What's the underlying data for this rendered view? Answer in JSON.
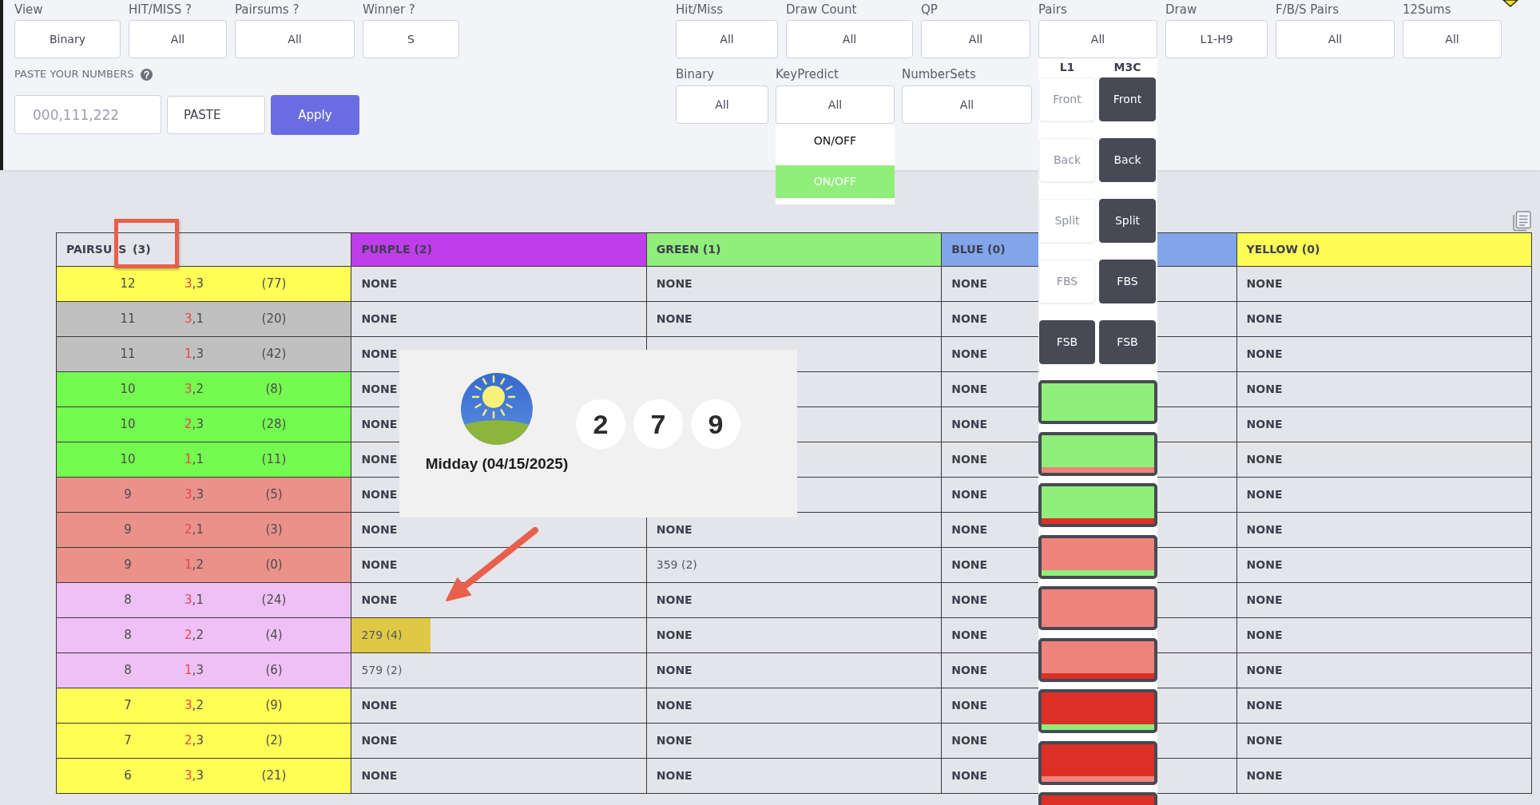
{
  "left_filters": [
    {
      "label": "View",
      "value": "Binary"
    },
    {
      "label": "HIT/MISS ?",
      "value": "All"
    },
    {
      "label": "Pairsums ?",
      "value": "All"
    },
    {
      "label": "Winner ?",
      "value": "S"
    }
  ],
  "paste_numbers": {
    "label": "PASTE YOUR NUMBERS",
    "placeholder": "000,111,222",
    "paste_button": "PASTE",
    "apply_button": "Apply"
  },
  "right_filters": [
    {
      "label": "Hit/Miss",
      "value": "All"
    },
    {
      "label": "Draw Count",
      "value": "All"
    },
    {
      "label": "QP",
      "value": "All"
    },
    {
      "label": "Pairs",
      "value": "All",
      "dropdown": {
        "kind": "pair_toggles",
        "headers": [
          "L1",
          "M3C"
        ],
        "rows": [
          [
            {
              "label": "Front",
              "selected": false
            },
            {
              "label": "Front",
              "selected": true
            }
          ],
          [
            {
              "label": "Back",
              "selected": false
            },
            {
              "label": "Back",
              "selected": true
            }
          ],
          [
            {
              "label": "Split",
              "selected": false
            },
            {
              "label": "Split",
              "selected": true
            }
          ],
          [
            {
              "label": "FBS",
              "selected": false
            },
            {
              "label": "FBS",
              "selected": true
            }
          ],
          [
            {
              "label": "FSB",
              "selected": true
            },
            {
              "label": "FSB",
              "selected": true
            }
          ]
        ],
        "swatches": [
          {
            "color": "#90ee7a"
          },
          {
            "color": "#90ee7a",
            "stripe": {
              "color": "#ef837c"
            }
          },
          {
            "color": "#90ee7a",
            "stripe": {
              "color": "#dc3026"
            }
          },
          {
            "color": "#ef837c",
            "stripe": {
              "color": "#90ee7a"
            }
          },
          {
            "color": "#ef837c"
          },
          {
            "color": "#ef837c",
            "stripe": {
              "color": "#dc3026"
            }
          },
          {
            "color": "#dc3026",
            "stripe": {
              "color": "#90ee7a"
            }
          },
          {
            "color": "#dc3026",
            "stripe": {
              "color": "#ef837c"
            }
          },
          {
            "color": "#dc3026"
          }
        ]
      }
    },
    {
      "label": "Draw",
      "value": "L1-H9"
    },
    {
      "label": "F/B/S Pairs",
      "value": "All"
    },
    {
      "label": "12Sums",
      "value": "All"
    }
  ],
  "right_filters_row2": [
    {
      "label": "Binary",
      "value": "All"
    },
    {
      "label": "KeyPredict",
      "value": "All",
      "dropdown": {
        "kind": "switch_list",
        "items": [
          {
            "label": "ON/OFF",
            "on": false
          },
          {
            "label": "ON/OFF",
            "on": true
          }
        ]
      }
    },
    {
      "label": "NumberSets",
      "value": "All"
    }
  ],
  "table": {
    "columns": [
      {
        "label": "PAIRSU S (3)",
        "color": "#e4e5ea"
      },
      {
        "label": "PURPLE (2)",
        "color": "#bf3deb"
      },
      {
        "label": "GREEN (1)",
        "color": "#90ee7a"
      },
      {
        "label": "BLUE (0)",
        "color": "#82a4eb"
      },
      {
        "label": "YELLOW (0)",
        "color": "#fffd55"
      }
    ],
    "rows": [
      {
        "cells": [
          {
            "kind": "pairsum",
            "sum": "12",
            "pair_hit": "3",
            "pair_rest": ",3",
            "count": "(77)",
            "color": "#ffff55"
          },
          {
            "kind": "none",
            "text": "NONE",
            "highlighted": false
          },
          {
            "kind": "none",
            "text": "NONE",
            "highlighted": false
          },
          {
            "kind": "none",
            "text": "NONE",
            "highlighted": false
          },
          {
            "kind": "none",
            "text": "NONE",
            "highlighted": false
          }
        ]
      },
      {
        "cells": [
          {
            "kind": "pairsum",
            "sum": "11",
            "pair_hit": "3",
            "pair_rest": ",1",
            "count": "(20)",
            "color": "#c0c0c0"
          },
          {
            "kind": "none",
            "text": "NONE",
            "highlighted": false
          },
          {
            "kind": "none",
            "text": "NONE",
            "highlighted": false
          },
          {
            "kind": "none",
            "text": "NONE",
            "highlighted": false
          },
          {
            "kind": "none",
            "text": "NONE",
            "highlighted": false
          }
        ]
      },
      {
        "cells": [
          {
            "kind": "pairsum",
            "sum": "11",
            "pair_hit": "1",
            "pair_rest": ",3",
            "count": "(42)",
            "color": "#c0c0c0"
          },
          {
            "kind": "none",
            "text": "NONE",
            "highlighted": false
          },
          null,
          {
            "kind": "none",
            "text": "NONE",
            "highlighted": false
          },
          {
            "kind": "none",
            "text": "NONE",
            "highlighted": false
          }
        ]
      },
      {
        "cells": [
          {
            "kind": "pairsum",
            "sum": "10",
            "pair_hit": "3",
            "pair_rest": ",2",
            "count": "(8)",
            "color": "#74fb4f"
          },
          {
            "kind": "none",
            "text": "NONE",
            "highlighted": false
          },
          null,
          {
            "kind": "none",
            "text": "NONE",
            "highlighted": false
          },
          {
            "kind": "none",
            "text": "NONE",
            "highlighted": false
          }
        ]
      },
      {
        "cells": [
          {
            "kind": "pairsum",
            "sum": "10",
            "pair_hit": "2",
            "pair_rest": ",3",
            "count": "(28)",
            "color": "#74fb4f"
          },
          {
            "kind": "none",
            "text": "NONE",
            "highlighted": false
          },
          null,
          {
            "kind": "none",
            "text": "NONE",
            "highlighted": false
          },
          {
            "kind": "none",
            "text": "NONE",
            "highlighted": false
          }
        ]
      },
      {
        "cells": [
          {
            "kind": "pairsum",
            "sum": "10",
            "pair_hit": "1",
            "pair_rest": ",1",
            "count": "(11)",
            "color": "#74fb4f"
          },
          {
            "kind": "none",
            "text": "NONE",
            "highlighted": false
          },
          null,
          {
            "kind": "none",
            "text": "NONE",
            "highlighted": false
          },
          {
            "kind": "none",
            "text": "NONE",
            "highlighted": false
          }
        ]
      },
      {
        "cells": [
          {
            "kind": "pairsum",
            "sum": "9",
            "pair_hit": "3",
            "pair_rest": ",3",
            "count": "(5)",
            "color": "#ea918a"
          },
          {
            "kind": "none",
            "text": "NONE",
            "highlighted": false
          },
          null,
          {
            "kind": "none",
            "text": "NONE",
            "highlighted": false
          },
          {
            "kind": "none",
            "text": "NONE",
            "highlighted": false
          }
        ]
      },
      {
        "cells": [
          {
            "kind": "pairsum",
            "sum": "9",
            "pair_hit": "2",
            "pair_rest": ",1",
            "count": "(3)",
            "color": "#ea918a"
          },
          {
            "kind": "none",
            "text": "NONE",
            "highlighted": false
          },
          {
            "kind": "none",
            "text": "NONE",
            "highlighted": false
          },
          {
            "kind": "none",
            "text": "NONE",
            "highlighted": false
          },
          {
            "kind": "none",
            "text": "NONE",
            "highlighted": false
          }
        ]
      },
      {
        "cells": [
          {
            "kind": "pairsum",
            "sum": "9",
            "pair_hit": "1",
            "pair_rest": ",2",
            "count": "(0)",
            "color": "#ea918a"
          },
          {
            "kind": "none",
            "text": "NONE",
            "highlighted": false
          },
          {
            "kind": "value",
            "text": "359 (2)",
            "highlighted": false
          },
          {
            "kind": "none",
            "text": "NONE",
            "highlighted": false
          },
          {
            "kind": "none",
            "text": "NONE",
            "highlighted": false
          }
        ]
      },
      {
        "cells": [
          {
            "kind": "pairsum",
            "sum": "8",
            "pair_hit": "3",
            "pair_rest": ",1",
            "count": "(24)",
            "color": "#efc0f6"
          },
          {
            "kind": "none",
            "text": "NONE",
            "highlighted": false
          },
          {
            "kind": "none",
            "text": "NONE",
            "highlighted": false
          },
          {
            "kind": "none",
            "text": "NONE",
            "highlighted": false
          },
          {
            "kind": "none",
            "text": "NONE",
            "highlighted": false
          }
        ]
      },
      {
        "cells": [
          {
            "kind": "pairsum",
            "sum": "8",
            "pair_hit": "2",
            "pair_rest": ",2",
            "count": "(4)",
            "color": "#efc0f6"
          },
          {
            "kind": "value",
            "text": "279 (4)",
            "highlighted": true
          },
          {
            "kind": "none",
            "text": "NONE",
            "highlighted": false
          },
          {
            "kind": "none",
            "text": "NONE",
            "highlighted": false
          },
          {
            "kind": "none",
            "text": "NONE",
            "highlighted": false
          }
        ]
      },
      {
        "cells": [
          {
            "kind": "pairsum",
            "sum": "8",
            "pair_hit": "1",
            "pair_rest": ",3",
            "count": "(6)",
            "color": "#efc0f6"
          },
          {
            "kind": "value",
            "text": "579 (2)",
            "highlighted": false
          },
          {
            "kind": "none",
            "text": "NONE",
            "highlighted": false
          },
          {
            "kind": "none",
            "text": "NONE",
            "highlighted": false
          },
          {
            "kind": "none",
            "text": "NONE",
            "highlighted": false
          }
        ]
      },
      {
        "cells": [
          {
            "kind": "pairsum",
            "sum": "7",
            "pair_hit": "3",
            "pair_rest": ",2",
            "count": "(9)",
            "color": "#ffff55"
          },
          {
            "kind": "none",
            "text": "NONE",
            "highlighted": false
          },
          {
            "kind": "none",
            "text": "NONE",
            "highlighted": false
          },
          {
            "kind": "none",
            "text": "NONE",
            "highlighted": false
          },
          {
            "kind": "none",
            "text": "NONE",
            "highlighted": false
          }
        ]
      },
      {
        "cells": [
          {
            "kind": "pairsum",
            "sum": "7",
            "pair_hit": "2",
            "pair_rest": ",3",
            "count": "(2)",
            "color": "#ffff55"
          },
          {
            "kind": "none",
            "text": "NONE",
            "highlighted": false
          },
          {
            "kind": "none",
            "text": "NONE",
            "highlighted": false
          },
          {
            "kind": "none",
            "text": "NONE",
            "highlighted": false
          },
          {
            "kind": "none",
            "text": "NONE",
            "highlighted": false
          }
        ]
      },
      {
        "cells": [
          {
            "kind": "pairsum",
            "sum": "6",
            "pair_hit": "3",
            "pair_rest": ",3",
            "count": "(21)",
            "color": "#ffff55"
          },
          {
            "kind": "none",
            "text": "NONE",
            "highlighted": false
          },
          {
            "kind": "none",
            "text": "NONE",
            "highlighted": false
          },
          {
            "kind": "none",
            "text": "NONE",
            "highlighted": false
          },
          {
            "kind": "none",
            "text": "NONE",
            "highlighted": false
          }
        ]
      }
    ]
  },
  "popup": {
    "title": "Midday (04/15/2025)",
    "numbers": [
      "2",
      "7",
      "9"
    ]
  }
}
